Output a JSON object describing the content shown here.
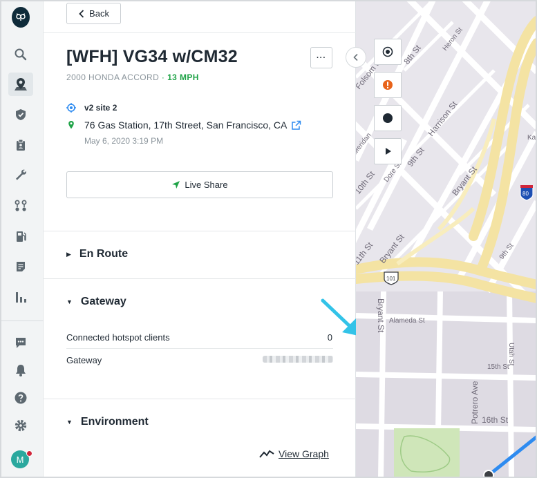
{
  "nav": {
    "back_label": "Back",
    "items": [
      {
        "icon": "search-icon"
      },
      {
        "icon": "map-pin-user-icon",
        "active": true
      },
      {
        "icon": "shield-icon"
      },
      {
        "icon": "clipboard-icon"
      },
      {
        "icon": "wrench-icon"
      },
      {
        "icon": "routes-icon"
      },
      {
        "icon": "fuel-icon"
      },
      {
        "icon": "document-icon"
      },
      {
        "icon": "bar-chart-icon"
      },
      {
        "icon": "chat-icon"
      },
      {
        "icon": "bell-icon"
      },
      {
        "icon": "help-icon"
      },
      {
        "icon": "gear-icon"
      }
    ],
    "avatar_initial": "M"
  },
  "vehicle": {
    "title": "[WFH] VG34 w/CM32",
    "model": "2000 HONDA ACCORD",
    "separator": "·",
    "speed": "13 MPH",
    "more_label": "···"
  },
  "location": {
    "site": "v2 site 2",
    "address": "76 Gas Station, 17th Street, San Francisco, CA",
    "timestamp": "May 6, 2020 3:19 PM"
  },
  "live_share_label": "Live Share",
  "sections": {
    "en_route": "En Route",
    "gateway": "Gateway",
    "environment": "Environment"
  },
  "gateway": {
    "hotspot_label": "Connected hotspot clients",
    "hotspot_value": "0",
    "gateway_label": "Gateway"
  },
  "environment": {
    "view_graph_label": "View Graph"
  },
  "map": {
    "street_labels": [
      "8th St",
      "Heron St",
      "Folsom St",
      "Harrison St",
      "9th St",
      "Dore St",
      "10th St",
      "Bryant St",
      "11th St",
      "Alameda St",
      "15th St",
      "16th St",
      "Utah St",
      "Potrero Ave",
      "Bryant St",
      "9th St",
      "Meridan",
      "Ka",
      "Bryant St"
    ],
    "highway_labels": [
      "80",
      "101"
    ],
    "controls": [
      {
        "icon": "target-icon"
      },
      {
        "icon": "alert-icon"
      },
      {
        "icon": "record-icon"
      },
      {
        "icon": "play-icon"
      }
    ]
  },
  "colors": {
    "accent_green": "#1fa347",
    "annotation_arrow": "#33c3e8",
    "alert_orange": "#e8631a",
    "route_blue": "#2e8bf0"
  }
}
